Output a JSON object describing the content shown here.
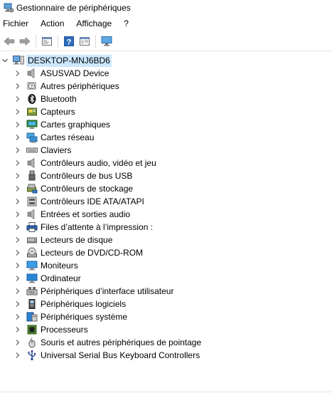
{
  "window": {
    "title": "Gestionnaire de périphériques"
  },
  "menu": [
    "Fichier",
    "Action",
    "Affichage",
    "?"
  ],
  "toolbar": {
    "buttons": [
      "back-arrow-icon",
      "forward-arrow-icon",
      "properties-icon",
      "help-icon",
      "show-hide-icon",
      "monitor-icon"
    ]
  },
  "tree": {
    "root": "DESKTOP-MNJ6BD6",
    "items": [
      {
        "label": "ASUSVAD Device",
        "icon": "speaker-icon"
      },
      {
        "label": "Autres périphériques",
        "icon": "unknown-device-icon"
      },
      {
        "label": "Bluetooth",
        "icon": "bluetooth-icon"
      },
      {
        "label": "Capteurs",
        "icon": "sensor-icon"
      },
      {
        "label": "Cartes graphiques",
        "icon": "display-adapter-icon"
      },
      {
        "label": "Cartes réseau",
        "icon": "network-adapter-icon"
      },
      {
        "label": "Claviers",
        "icon": "keyboard-icon"
      },
      {
        "label": "Contrôleurs audio, vidéo et jeu",
        "icon": "speaker-icon"
      },
      {
        "label": "Contrôleurs de bus USB",
        "icon": "usb-icon"
      },
      {
        "label": "Contrôleurs de stockage",
        "icon": "storage-controller-icon"
      },
      {
        "label": "Contrôleurs IDE ATA/ATAPI",
        "icon": "ide-controller-icon"
      },
      {
        "label": "Entrées et sorties audio",
        "icon": "speaker-icon"
      },
      {
        "label": "Files d’attente à l’impression :",
        "icon": "printer-icon"
      },
      {
        "label": "Lecteurs de disque",
        "icon": "disk-drive-icon"
      },
      {
        "label": "Lecteurs de DVD/CD-ROM",
        "icon": "dvd-drive-icon"
      },
      {
        "label": "Moniteurs",
        "icon": "monitor-icon"
      },
      {
        "label": "Ordinateur",
        "icon": "computer-icon"
      },
      {
        "label": "Périphériques d’interface utilisateur",
        "icon": "hid-icon"
      },
      {
        "label": "Périphériques logiciels",
        "icon": "software-device-icon"
      },
      {
        "label": "Périphériques système",
        "icon": "system-device-icon"
      },
      {
        "label": "Processeurs",
        "icon": "processor-icon"
      },
      {
        "label": "Souris et autres périphériques de pointage",
        "icon": "mouse-icon"
      },
      {
        "label": "Universal Serial Bus Keyboard Controllers",
        "icon": "usb-keyboard-controller-icon"
      }
    ]
  }
}
